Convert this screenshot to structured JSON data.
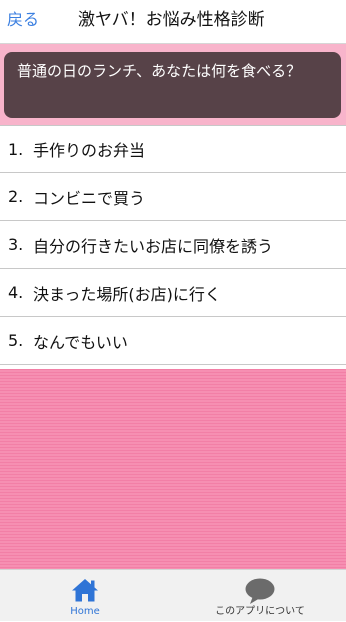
{
  "header": {
    "back_label": "戻る",
    "title": "激ヤバ！お悩み性格診断"
  },
  "question": {
    "text": "普通の日のランチ、あなたは何を食べる？"
  },
  "answers": [
    {
      "number": "1.",
      "text": "手作りのお弁当"
    },
    {
      "number": "2.",
      "text": "コンビニで買う"
    },
    {
      "number": "3.",
      "text": "自分の行きたいお店に同僚を誘う"
    },
    {
      "number": "4.",
      "text": "決まった場所(お店)に行く"
    },
    {
      "number": "5.",
      "text": "なんでもいい"
    }
  ],
  "tabbar": {
    "home": {
      "label": "Home",
      "icon": "home-icon",
      "color": "#2f74d6"
    },
    "about": {
      "label": "このアプリについて",
      "icon": "speech-bubble-icon",
      "color": "#6b6b6b"
    }
  },
  "colors": {
    "accent_blue": "#3b7fe0",
    "pink_band": "#f8b4cb",
    "pink_area": "#f485ab",
    "question_box": "#574248"
  }
}
